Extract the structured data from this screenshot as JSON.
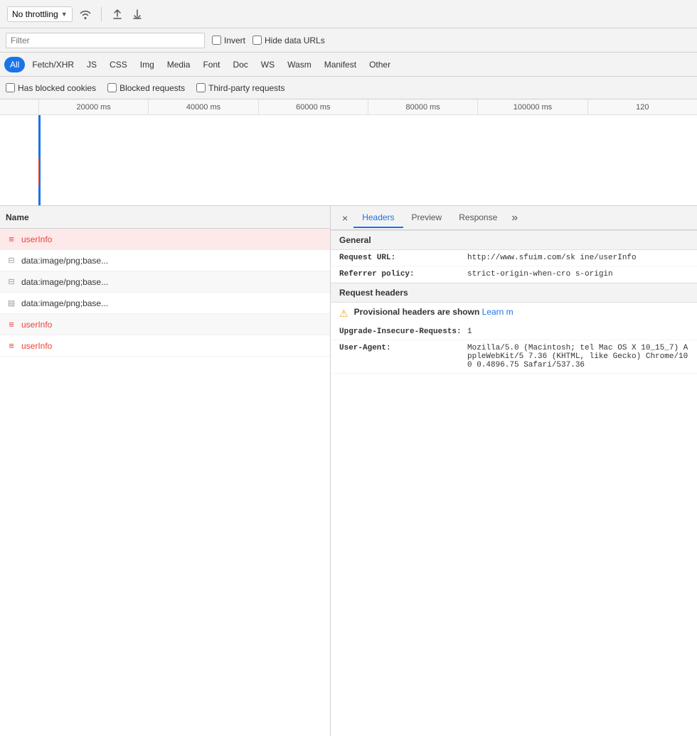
{
  "toolbar": {
    "throttle_label": "No throttling",
    "upload_icon": "↑",
    "download_icon": "↓",
    "wifi_icon": "wifi"
  },
  "filter": {
    "placeholder": "Filter",
    "invert_label": "Invert",
    "hide_data_urls_label": "Hide data URLs"
  },
  "filter_tabs": [
    {
      "id": "all",
      "label": "All",
      "active": true
    },
    {
      "id": "fetch_xhr",
      "label": "Fetch/XHR",
      "active": false
    },
    {
      "id": "js",
      "label": "JS",
      "active": false
    },
    {
      "id": "css",
      "label": "CSS",
      "active": false
    },
    {
      "id": "img",
      "label": "Img",
      "active": false
    },
    {
      "id": "media",
      "label": "Media",
      "active": false
    },
    {
      "id": "font",
      "label": "Font",
      "active": false
    },
    {
      "id": "doc",
      "label": "Doc",
      "active": false
    },
    {
      "id": "ws",
      "label": "WS",
      "active": false
    },
    {
      "id": "wasm",
      "label": "Wasm",
      "active": false
    },
    {
      "id": "manifest",
      "label": "Manifest",
      "active": false
    },
    {
      "id": "other",
      "label": "Other",
      "active": false
    }
  ],
  "extra_filters": {
    "blocked_cookies": "Has blocked cookies",
    "blocked_requests": "Blocked requests",
    "third_party": "Third-party requests"
  },
  "timeline": {
    "ticks": [
      "20000 ms",
      "40000 ms",
      "60000 ms",
      "80000 ms",
      "100000 ms",
      "120"
    ]
  },
  "request_list": {
    "header": "Name",
    "items": [
      {
        "id": 1,
        "name": "userInfo",
        "icon_type": "doc-red",
        "selected": true
      },
      {
        "id": 2,
        "name": "data:image/png;base...",
        "icon_type": "img-gray",
        "selected": false,
        "alt": false
      },
      {
        "id": 3,
        "name": "data:image/png;base...",
        "icon_type": "img-gray",
        "selected": false,
        "alt": true
      },
      {
        "id": 4,
        "name": "data:image/png;base...",
        "icon_type": "file-gray",
        "selected": false,
        "alt": false
      },
      {
        "id": 5,
        "name": "userInfo",
        "icon_type": "doc-red",
        "selected": false,
        "alt": true
      },
      {
        "id": 6,
        "name": "userInfo",
        "icon_type": "doc-red",
        "selected": false,
        "alt": false
      }
    ]
  },
  "details": {
    "tabs": [
      {
        "label": "×",
        "id": "close"
      },
      {
        "label": "Headers",
        "id": "headers",
        "active": true
      },
      {
        "label": "Preview",
        "id": "preview",
        "active": false
      },
      {
        "label": "Response",
        "id": "response",
        "active": false
      },
      {
        "label": "»",
        "id": "more"
      }
    ],
    "sections": [
      {
        "title": "General",
        "fields": [
          {
            "key": "Request URL:",
            "value": "http://www.sfuim.com/sk\nine/userInfo"
          },
          {
            "key": "Referrer policy:",
            "value": "strict-origin-when-cro\ns-origin"
          }
        ]
      },
      {
        "title": "Request headers",
        "warning": {
          "icon": "⚠",
          "text": "Provisional headers are shown",
          "link_text": "Learn m"
        },
        "fields": [
          {
            "key": "Upgrade-Insecure-Requests:",
            "value": "1"
          },
          {
            "key": "User-Agent:",
            "value": "Mozilla/5.0 (Macintosh;\ntel Mac OS X 10_15_7) AppleWebKit/5\n7.36 (KHTML, like Gecko) Chrome/100\n0.4896.75 Safari/537.36"
          }
        ]
      }
    ]
  }
}
